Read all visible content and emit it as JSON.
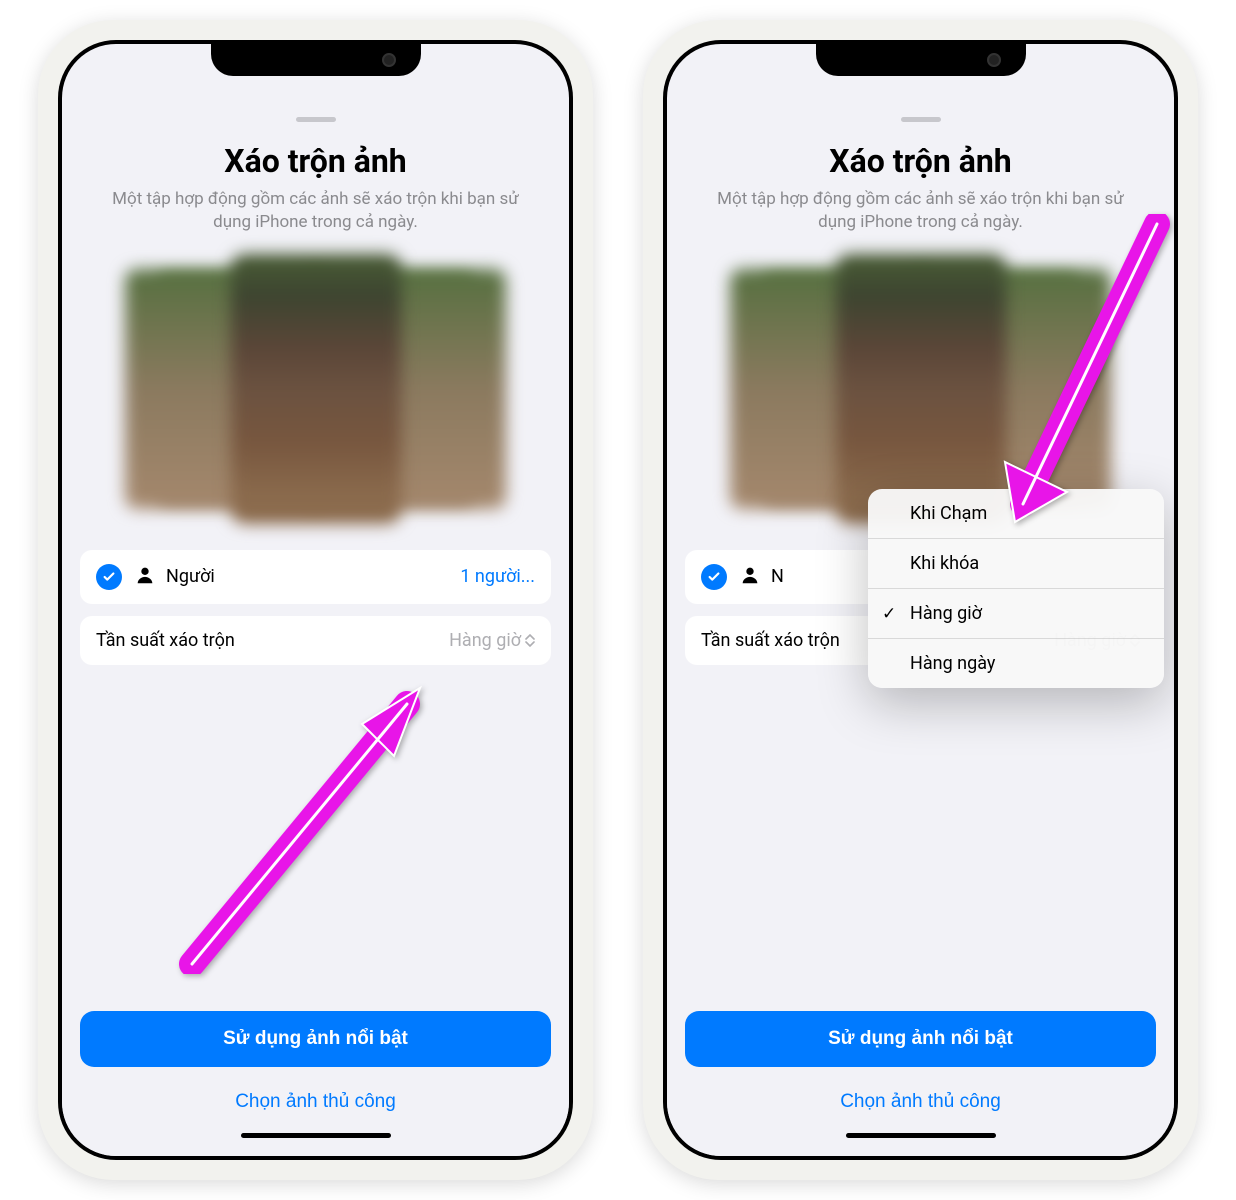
{
  "left_phone": {
    "title": "Xáo trộn ảnh",
    "subtitle": "Một tập hợp động gồm các ảnh sẽ xáo trộn khi bạn sử dụng iPhone trong cả ngày.",
    "people_row": {
      "label": "Người",
      "value": "1 người..."
    },
    "frequency_row": {
      "label": "Tần suất xáo trộn",
      "value": "Hàng giờ"
    },
    "primary_button": "Sử dụng ảnh nổi bật",
    "secondary_button": "Chọn ảnh thủ công"
  },
  "right_phone": {
    "title": "Xáo trộn ảnh",
    "subtitle": "Một tập hợp động gồm các ảnh sẽ xáo trộn khi bạn sử dụng iPhone trong cả ngày.",
    "people_row": {
      "label": "N",
      "value": ""
    },
    "frequency_row": {
      "label": "Tần suất xáo trộn",
      "value": "Hàng giờ"
    },
    "primary_button": "Sử dụng ảnh nổi bật",
    "secondary_button": "Chọn ảnh thủ công",
    "dropdown": {
      "items": [
        {
          "label": "Khi Chạm",
          "selected": false
        },
        {
          "label": "Khi khóa",
          "selected": false
        },
        {
          "label": "Hàng giờ",
          "selected": true
        },
        {
          "label": "Hàng ngày",
          "selected": false
        }
      ]
    }
  }
}
